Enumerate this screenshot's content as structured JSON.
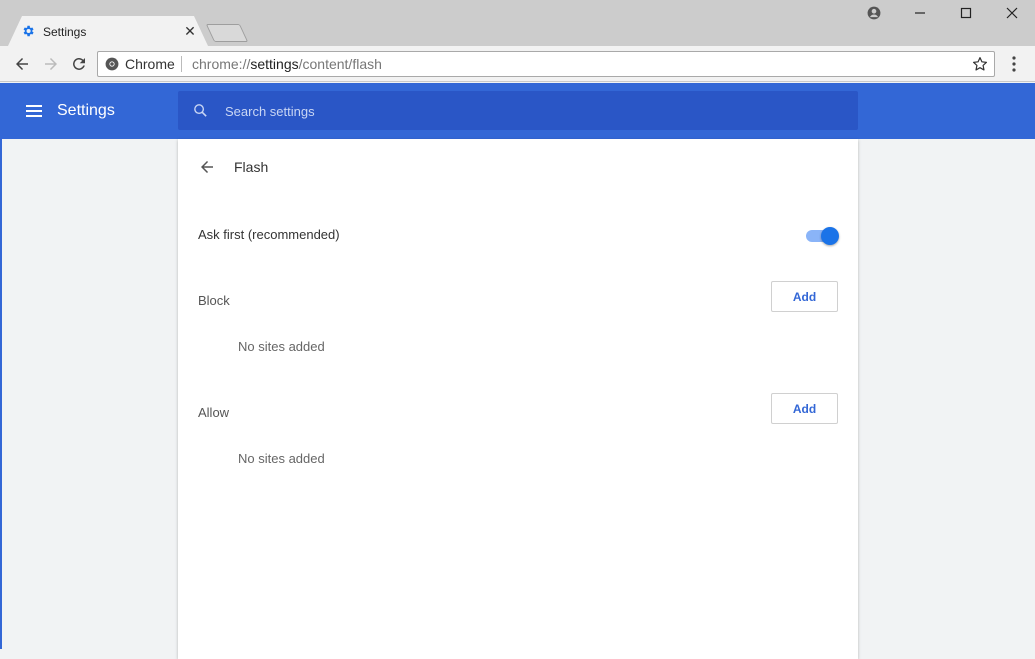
{
  "browser": {
    "tab": {
      "title": "Settings",
      "close_glyph": "✕",
      "favicon": "gear-icon"
    },
    "omnibox": {
      "site_label": "Chrome",
      "url_scheme": "chrome://",
      "url_host": "settings",
      "url_path": "/content/flash"
    }
  },
  "header": {
    "title": "Settings",
    "search_placeholder": "Search settings"
  },
  "page": {
    "title": "Flash",
    "toggle": {
      "label": "Ask first (recommended)",
      "enabled": true
    },
    "sections": [
      {
        "label": "Block",
        "add_label": "Add",
        "empty_text": "No sites added"
      },
      {
        "label": "Allow",
        "add_label": "Add",
        "empty_text": "No sites added"
      }
    ]
  },
  "colors": {
    "accent": "#3367d6",
    "search_bg": "#2a56c6",
    "toggle_on": "#1a73e8"
  }
}
